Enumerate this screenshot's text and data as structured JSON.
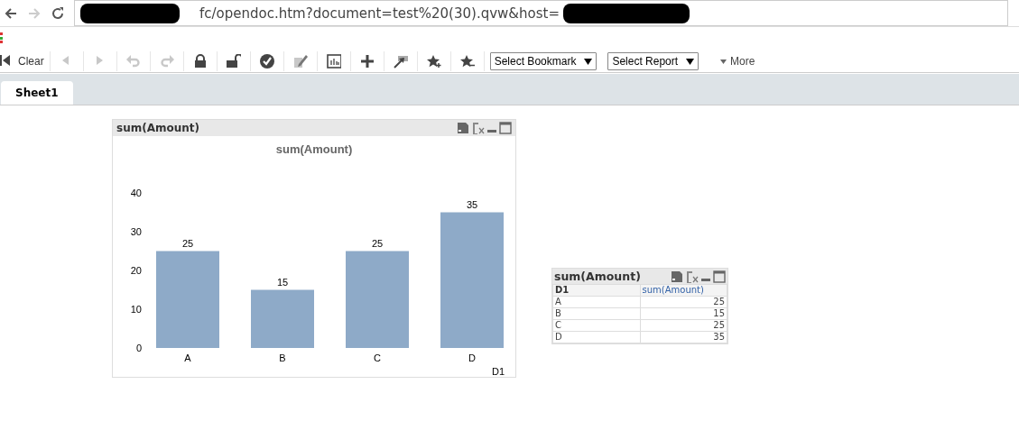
{
  "browser": {
    "address": "fc/opendoc.htm?document=test%20(30).qvw&host=",
    "back_disabled": false,
    "forward_disabled": true
  },
  "toolbar": {
    "items": [
      {
        "kind": "clear",
        "label": "Clear",
        "disabled": false
      },
      {
        "kind": "back",
        "disabled": true
      },
      {
        "kind": "forward",
        "disabled": true
      },
      {
        "kind": "undo",
        "disabled": true
      },
      {
        "kind": "redo",
        "disabled": true
      },
      {
        "kind": "lock",
        "disabled": false
      },
      {
        "kind": "unlock",
        "disabled": false
      },
      {
        "kind": "check",
        "disabled": false
      },
      {
        "kind": "edit",
        "disabled": true
      },
      {
        "kind": "chart",
        "disabled": false
      },
      {
        "kind": "plus",
        "disabled": false
      },
      {
        "kind": "arrow",
        "disabled": false
      },
      {
        "kind": "star-add",
        "disabled": false
      },
      {
        "kind": "star-remove",
        "disabled": false
      },
      {
        "kind": "dropdown",
        "label": "Select Bookmark"
      },
      {
        "kind": "dropdown",
        "label": "Select Report"
      },
      {
        "kind": "more",
        "label": "More"
      }
    ]
  },
  "tabs": [
    {
      "label": "Sheet1",
      "selected": true
    }
  ],
  "chart_object": {
    "caption": "sum(Amount)",
    "chart_data": {
      "type": "bar",
      "title": "sum(Amount)",
      "xlabel": "D1",
      "categories": [
        "A",
        "B",
        "C",
        "D"
      ],
      "series": [
        {
          "color": "#8eaac8",
          "values": [
            25,
            15,
            25,
            35
          ]
        }
      ],
      "ylim": [
        0,
        40
      ],
      "yticks": [
        0,
        10,
        20,
        30,
        40
      ],
      "data_labels": true
    }
  },
  "table_object": {
    "caption": "sum(Amount)",
    "columns": [
      "D1",
      "sum(Amount)"
    ],
    "rows": [
      [
        "A",
        "25"
      ],
      [
        "B",
        "15"
      ],
      [
        "C",
        "25"
      ],
      [
        "D",
        "35"
      ]
    ]
  }
}
